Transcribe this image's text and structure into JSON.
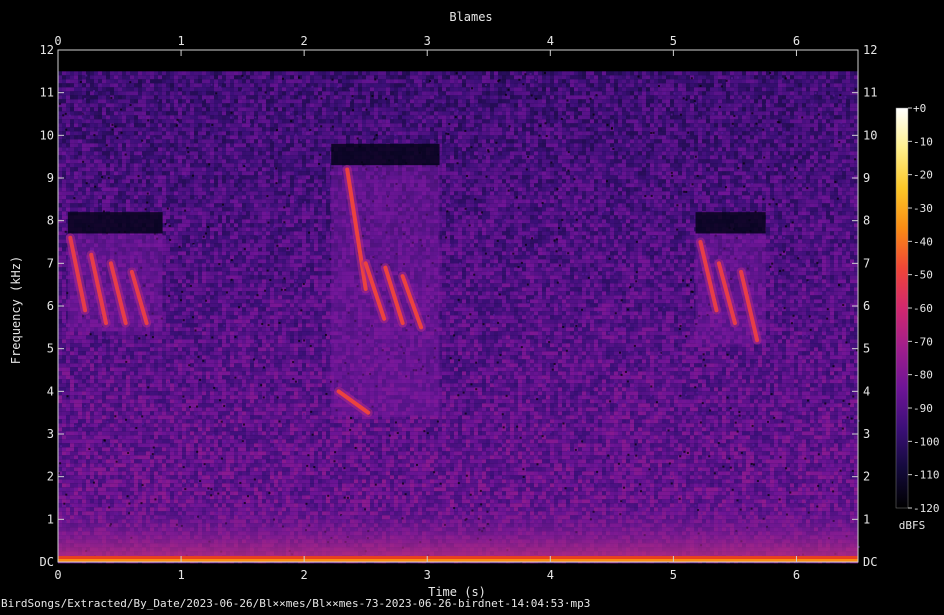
{
  "chart_data": {
    "type": "heatmap",
    "title": "Blames",
    "xlabel": "Time (s)",
    "ylabel": "Frequency (kHz)",
    "xlim": [
      0,
      6.5
    ],
    "ylim": [
      0,
      12
    ],
    "x_ticks": [
      {
        "value": 0,
        "label": "0"
      },
      {
        "value": 1,
        "label": "1"
      },
      {
        "value": 2,
        "label": "2"
      },
      {
        "value": 3,
        "label": "3"
      },
      {
        "value": 4,
        "label": "4"
      },
      {
        "value": 5,
        "label": "5"
      },
      {
        "value": 6,
        "label": "6"
      }
    ],
    "y_ticks": [
      {
        "value": 0,
        "label": "DC"
      },
      {
        "value": 1,
        "label": "1"
      },
      {
        "value": 2,
        "label": "2"
      },
      {
        "value": 3,
        "label": "3"
      },
      {
        "value": 4,
        "label": "4"
      },
      {
        "value": 5,
        "label": "5"
      },
      {
        "value": 6,
        "label": "6"
      },
      {
        "value": 7,
        "label": "7"
      },
      {
        "value": 8,
        "label": "8"
      },
      {
        "value": 9,
        "label": "9"
      },
      {
        "value": 10,
        "label": "10"
      },
      {
        "value": 11,
        "label": "11"
      },
      {
        "value": 12,
        "label": "12"
      }
    ],
    "colorbar": {
      "label": "dBFS",
      "range": [
        -120,
        0
      ],
      "ticks": [
        {
          "value": 0,
          "label": "+0"
        },
        {
          "value": -10,
          "label": "-10"
        },
        {
          "value": -20,
          "label": "-20"
        },
        {
          "value": -30,
          "label": "-30"
        },
        {
          "value": -40,
          "label": "-40"
        },
        {
          "value": -50,
          "label": "-50"
        },
        {
          "value": -60,
          "label": "-60"
        },
        {
          "value": -70,
          "label": "-70"
        },
        {
          "value": -80,
          "label": "-80"
        },
        {
          "value": -90,
          "label": "-90"
        },
        {
          "value": -100,
          "label": "-100"
        },
        {
          "value": -110,
          "label": "-110"
        },
        {
          "value": -120,
          "label": "-120"
        }
      ]
    },
    "colormap": [
      "#000000",
      "#140a3c",
      "#3c0f78",
      "#6e1496",
      "#a01e8c",
      "#d2286e",
      "#f04637",
      "#fa8c14",
      "#fcc828",
      "#fff08c",
      "#ffffff"
    ],
    "signal_cutoff_khz": 11.5,
    "calls": [
      {
        "start_s": 0.08,
        "end_s": 0.85,
        "freq_top_khz": 7.7,
        "freq_bottom_khz": 5.4,
        "level_dbfs": -60,
        "notes": [
          {
            "t_start": 0.1,
            "t_end": 0.22,
            "f_start": 7.6,
            "f_end": 5.9
          },
          {
            "t_start": 0.27,
            "t_end": 0.39,
            "f_start": 7.2,
            "f_end": 5.6
          },
          {
            "t_start": 0.43,
            "t_end": 0.55,
            "f_start": 7.0,
            "f_end": 5.6
          },
          {
            "t_start": 0.6,
            "t_end": 0.72,
            "f_start": 6.8,
            "f_end": 5.6
          }
        ]
      },
      {
        "start_s": 2.22,
        "end_s": 3.1,
        "freq_top_khz": 9.3,
        "freq_bottom_khz": 3.4,
        "level_dbfs": -58,
        "notes": [
          {
            "t_start": 2.35,
            "t_end": 2.5,
            "f_start": 9.2,
            "f_end": 6.4
          },
          {
            "t_start": 2.5,
            "t_end": 2.65,
            "f_start": 7.0,
            "f_end": 5.7
          },
          {
            "t_start": 2.66,
            "t_end": 2.8,
            "f_start": 6.9,
            "f_end": 5.6
          },
          {
            "t_start": 2.8,
            "t_end": 2.95,
            "f_start": 6.7,
            "f_end": 5.5
          },
          {
            "t_start": 2.28,
            "t_end": 2.52,
            "f_start": 4.0,
            "f_end": 3.5
          }
        ]
      },
      {
        "start_s": 5.18,
        "end_s": 5.75,
        "freq_top_khz": 7.7,
        "freq_bottom_khz": 5.1,
        "level_dbfs": -60,
        "notes": [
          {
            "t_start": 5.22,
            "t_end": 5.35,
            "f_start": 7.5,
            "f_end": 5.9
          },
          {
            "t_start": 5.37,
            "t_end": 5.5,
            "f_start": 7.0,
            "f_end": 5.6
          },
          {
            "t_start": 5.55,
            "t_end": 5.68,
            "f_start": 6.8,
            "f_end": 5.2
          }
        ]
      }
    ]
  },
  "footer": {
    "filename": "BirdSongs/Extracted/By_Date/2023-06-26/Bl××mes/Bl××mes-73-2023-06-26-birdnet-14:04:53·mp3"
  }
}
